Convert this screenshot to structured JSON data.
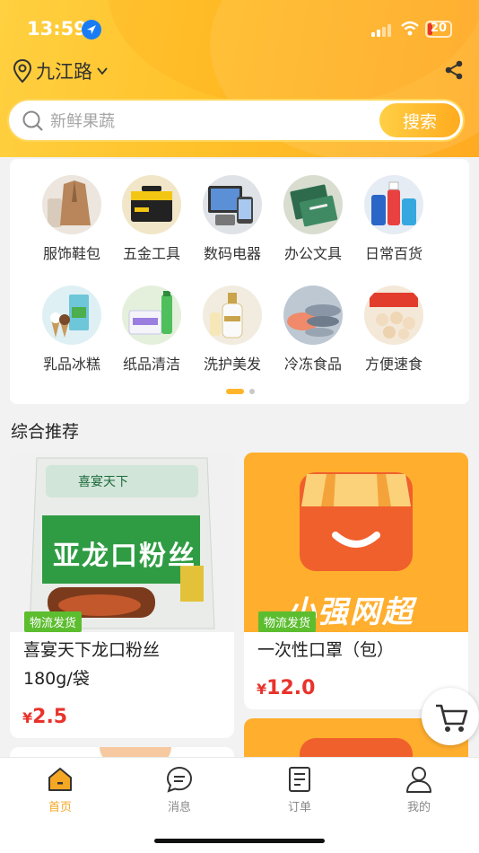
{
  "status_bar": {
    "time": "13:59",
    "battery": "20"
  },
  "location": {
    "name": "九江路"
  },
  "search": {
    "placeholder": "新鲜果蔬",
    "button_label": "搜索"
  },
  "categories": [
    {
      "label": "服饰鞋包",
      "icon": "clothing-icon"
    },
    {
      "label": "五金工具",
      "icon": "toolbox-icon"
    },
    {
      "label": "数码电器",
      "icon": "electronics-icon"
    },
    {
      "label": "办公文具",
      "icon": "stationery-icon"
    },
    {
      "label": "日常百货",
      "icon": "household-icon"
    },
    {
      "label": "乳品冰糕",
      "icon": "dairy-icon"
    },
    {
      "label": "纸品清洁",
      "icon": "paper-cleaning-icon"
    },
    {
      "label": "洗护美发",
      "icon": "haircare-icon"
    },
    {
      "label": "冷冻食品",
      "icon": "frozen-food-icon"
    },
    {
      "label": "方便速食",
      "icon": "instant-food-icon"
    }
  ],
  "section": {
    "title": "综合推荐"
  },
  "products": [
    {
      "tag": "物流发货",
      "title_line1": "喜宴天下龙口粉丝",
      "title_line2": "180g/袋",
      "currency": "¥",
      "price": "2.5",
      "package_brand": "喜宴天下",
      "package_name": "亚龙口粉丝"
    },
    {
      "tag": "物流发货",
      "title_line1": "一次性口罩（包）",
      "currency": "¥",
      "price": "12.0",
      "store_brand": "小强网超"
    }
  ],
  "tabbar": [
    {
      "label": "首页",
      "icon": "home-icon",
      "active": true
    },
    {
      "label": "消息",
      "icon": "message-icon",
      "active": false
    },
    {
      "label": "订单",
      "icon": "order-icon",
      "active": false
    },
    {
      "label": "我的",
      "icon": "profile-icon",
      "active": false
    }
  ],
  "colors": {
    "accent": "#f5a623",
    "price": "#e8332c",
    "tag": "#5cbd2f",
    "store_orange": "#ffae2e"
  }
}
